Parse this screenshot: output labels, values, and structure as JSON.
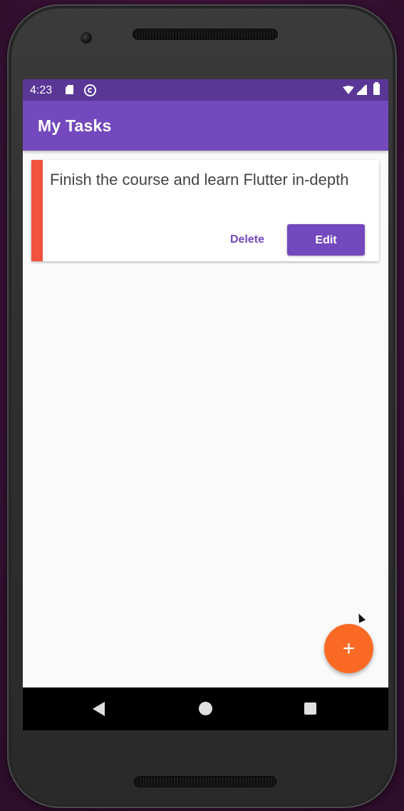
{
  "status_bar": {
    "time": "4:23",
    "icons": [
      "sd-card-icon",
      "sync-icon",
      "wifi-icon",
      "signal-icon",
      "battery-icon"
    ]
  },
  "app_bar": {
    "title": "My Tasks",
    "color": "#7349bd"
  },
  "tasks": [
    {
      "text": "Finish the course and learn Flutter in-depth",
      "stripe_color": "#f1533f",
      "delete_label": "Delete",
      "edit_label": "Edit"
    }
  ],
  "fab": {
    "icon": "plus-icon",
    "glyph": "+",
    "color": "#fb6a25"
  },
  "nav_bar": {
    "icons": [
      "back-icon",
      "home-icon",
      "recents-icon"
    ]
  }
}
